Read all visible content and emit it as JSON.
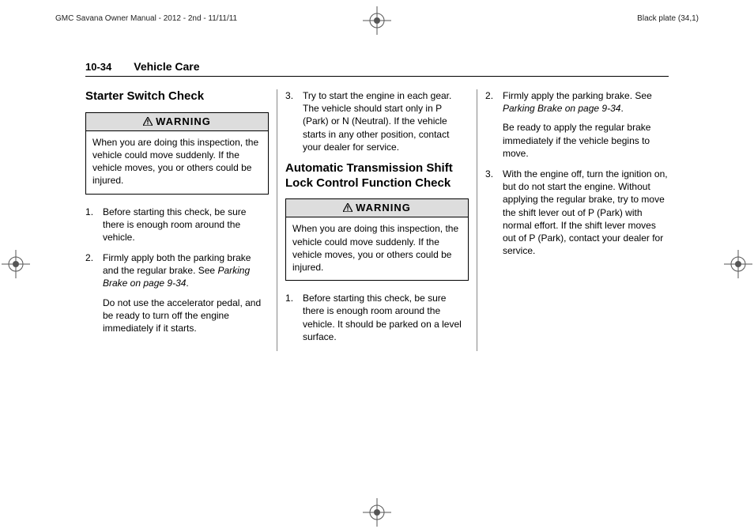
{
  "header": {
    "left": "GMC Savana Owner Manual - 2012 - 2nd - 11/11/11",
    "right": "Black plate (34,1)"
  },
  "page": {
    "number": "10-34",
    "chapter": "Vehicle Care"
  },
  "col1": {
    "heading": "Starter Switch Check",
    "warning_label": "WARNING",
    "warning_body": "When you are doing this inspection, the vehicle could move suddenly. If the vehicle moves, you or others could be injured.",
    "steps": {
      "s1": "Before starting this check, be sure there is enough room around the vehicle.",
      "s2a": "Firmly apply both the parking brake and the regular brake. See ",
      "s2ref": "Parking Brake on page 9‑34",
      "s2b": ".",
      "s2p2": "Do not use the accelerator pedal, and be ready to turn off the engine immediately if it starts."
    }
  },
  "col2": {
    "top_step": "Try to start the engine in each gear. The vehicle should start only in P (Park) or N (Neutral). If the vehicle starts in any other position, contact your dealer for service.",
    "heading": "Automatic Transmission Shift Lock Control Function Check",
    "warning_label": "WARNING",
    "warning_body": "When you are doing this inspection, the vehicle could move suddenly. If the vehicle moves, you or others could be injured.",
    "steps": {
      "s1": "Before starting this check, be sure there is enough room around the vehicle. It should be parked on a level surface."
    }
  },
  "col3": {
    "steps": {
      "s2a": "Firmly apply the parking brake. See ",
      "s2ref": "Parking Brake on page 9‑34",
      "s2b": ".",
      "s2p2": "Be ready to apply the regular brake immediately if the vehicle begins to move.",
      "s3": "With the engine off, turn the ignition on, but do not start the engine. Without applying the regular brake, try to move the shift lever out of P (Park) with normal effort. If the shift lever moves out of P (Park), contact your dealer for service."
    }
  }
}
